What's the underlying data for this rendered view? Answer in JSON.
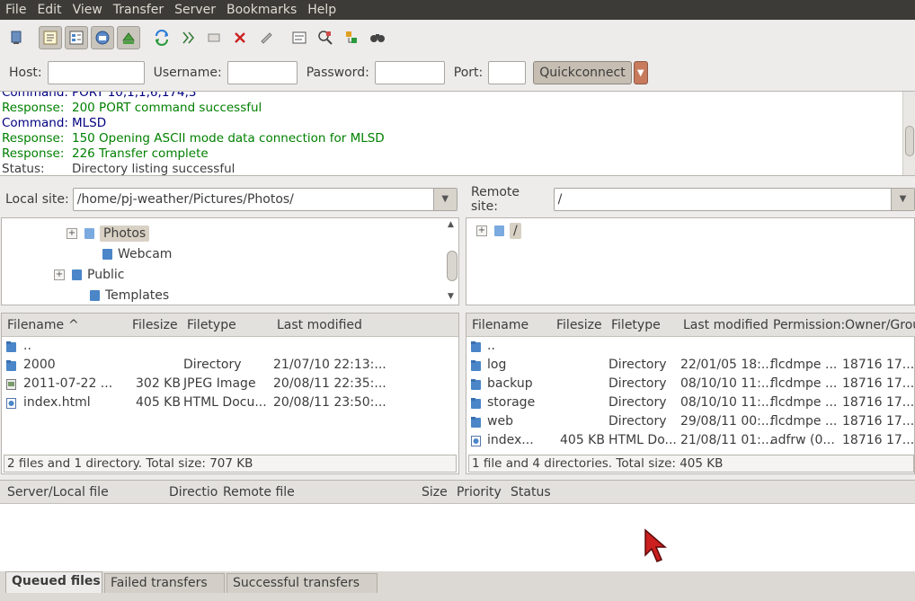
{
  "menubar": [
    "File",
    "Edit",
    "View",
    "Transfer",
    "Server",
    "Bookmarks",
    "Help"
  ],
  "toolbar": {
    "icons": [
      "site-manager-icon",
      "toggle-log-icon",
      "toggle-local-tree-icon",
      "toggle-remote-tree-icon",
      "toggle-queue-icon",
      "refresh-icon",
      "process-queue-icon",
      "cancel-icon",
      "disconnect-icon",
      "reconnect-icon",
      "filter-icon",
      "compare-icon",
      "sync-browse-icon",
      "search-icon"
    ]
  },
  "quickconnect": {
    "host_label": "Host:",
    "host_value": "",
    "username_label": "Username:",
    "username_value": "",
    "password_label": "Password:",
    "password_value": "",
    "port_label": "Port:",
    "port_value": "",
    "button_label": "Quickconnect"
  },
  "log": [
    {
      "label": "Command:",
      "text": "PORT 10,1,1,6,174,3",
      "kind": "cmd"
    },
    {
      "label": "Response:",
      "text": "200 PORT command successful",
      "kind": "resp"
    },
    {
      "label": "Command:",
      "text": "MLSD",
      "kind": "cmd"
    },
    {
      "label": "Response:",
      "text": "150 Opening ASCII mode data connection for MLSD",
      "kind": "resp"
    },
    {
      "label": "Response:",
      "text": "226 Transfer complete",
      "kind": "resp"
    },
    {
      "label": "Status:",
      "text": "Directory listing successful",
      "kind": "status"
    }
  ],
  "local": {
    "site_label": "Local site:",
    "path": "/home/pj-weather/Pictures/Photos/",
    "tree": [
      {
        "name": "Photos",
        "expander": "+",
        "selected": true
      },
      {
        "name": "Webcam",
        "expander": "",
        "selected": false
      },
      {
        "name": "Public",
        "expander": "+",
        "selected": false
      },
      {
        "name": "Templates",
        "expander": "",
        "selected": false
      }
    ],
    "columns": [
      "Filename",
      "Filesize",
      "Filetype",
      "Last modified"
    ],
    "sort_indicator": "^",
    "files": [
      {
        "name": "..",
        "size": "",
        "type": "",
        "modified": "",
        "icon": "folder"
      },
      {
        "name": "2000",
        "size": "",
        "type": "Directory",
        "modified": "21/07/10 22:13:...",
        "icon": "folder"
      },
      {
        "name": "2011-07-22 ...",
        "size": "302 KB",
        "type": "JPEG Image",
        "modified": "20/08/11 22:35:...",
        "icon": "image"
      },
      {
        "name": "index.html",
        "size": "405 KB",
        "type": "HTML Docu...",
        "modified": "20/08/11 23:50:...",
        "icon": "html"
      }
    ],
    "status": "2 files and 1 directory. Total size: 707 KB"
  },
  "remote": {
    "site_label": "Remote site:",
    "path": "/",
    "tree": [
      {
        "name": "/",
        "expander": "+",
        "selected": true
      }
    ],
    "columns": [
      "Filename",
      "Filesize",
      "Filetype",
      "Last modified",
      "Permission:",
      "Owner/Grou"
    ],
    "files": [
      {
        "name": "..",
        "size": "",
        "type": "",
        "modified": "",
        "perm": "",
        "owner": "",
        "icon": "folder"
      },
      {
        "name": "log",
        "size": "",
        "type": "Directory",
        "modified": "22/01/05 18:...",
        "perm": "flcdmpe ...",
        "owner": "18716 17...",
        "icon": "folder"
      },
      {
        "name": "backup",
        "size": "",
        "type": "Directory",
        "modified": "08/10/10 11:...",
        "perm": "flcdmpe ...",
        "owner": "18716 17...",
        "icon": "folder"
      },
      {
        "name": "storage",
        "size": "",
        "type": "Directory",
        "modified": "08/10/10 11:...",
        "perm": "flcdmpe ...",
        "owner": "18716 17...",
        "icon": "folder"
      },
      {
        "name": "web",
        "size": "",
        "type": "Directory",
        "modified": "29/08/11 00:...",
        "perm": "flcdmpe ...",
        "owner": "18716 17...",
        "icon": "folder"
      },
      {
        "name": "index...",
        "size": "405 KB",
        "type": "HTML Do...",
        "modified": "21/08/11 01:...",
        "perm": "adfrw (0...",
        "owner": "18716 17...",
        "icon": "html"
      }
    ],
    "status": "1 file and 4 directories. Total size: 405 KB"
  },
  "queue": {
    "columns": [
      "Server/Local file",
      "Directio",
      "Remote file",
      "Size",
      "Priority",
      "Status"
    ]
  },
  "tabs": [
    "Queued files",
    "Failed transfers",
    "Successful transfers"
  ],
  "colors": {
    "menubar_bg": "#3c3b37",
    "command": "#000080",
    "response": "#008000",
    "folder": "#4a86c8",
    "cursor": "#cc1f1f"
  }
}
